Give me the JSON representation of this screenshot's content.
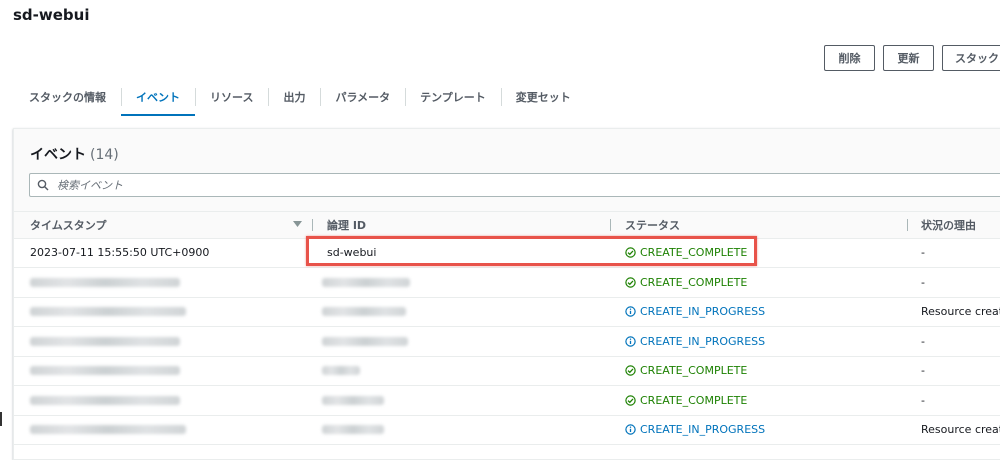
{
  "header": {
    "stack_name": "sd-webui"
  },
  "actions": {
    "delete_label": "削除",
    "update_label": "更新",
    "stack_actions_label": "スタックア"
  },
  "tabs": [
    {
      "label": "スタックの情報",
      "active": false
    },
    {
      "label": "イベント",
      "active": true
    },
    {
      "label": "リソース",
      "active": false
    },
    {
      "label": "出力",
      "active": false
    },
    {
      "label": "パラメータ",
      "active": false
    },
    {
      "label": "テンプレート",
      "active": false
    },
    {
      "label": "変更セット",
      "active": false
    }
  ],
  "events": {
    "title": "イベント",
    "count": "(14)",
    "search_placeholder": "検索イベント",
    "columns": {
      "timestamp": "タイムスタンプ",
      "logical_id": "論理 ID",
      "status": "ステータス",
      "reason": "状況の理由"
    },
    "rows": [
      {
        "timestamp": "2023-07-11 15:55:50 UTC+0900",
        "logical_id": "sd-webui",
        "status": "CREATE_COMPLETE",
        "status_type": "complete",
        "reason": "-"
      },
      {
        "timestamp": "",
        "logical_id": "",
        "status": "CREATE_COMPLETE",
        "status_type": "complete",
        "reason": "-"
      },
      {
        "timestamp": "",
        "logical_id": "",
        "status": "CREATE_IN_PROGRESS",
        "status_type": "progress",
        "reason": "Resource creation"
      },
      {
        "timestamp": "",
        "logical_id": "",
        "status": "CREATE_IN_PROGRESS",
        "status_type": "progress",
        "reason": "-"
      },
      {
        "timestamp": "",
        "logical_id": "",
        "status": "CREATE_COMPLETE",
        "status_type": "complete",
        "reason": "-"
      },
      {
        "timestamp": "",
        "logical_id": "",
        "status": "CREATE_COMPLETE",
        "status_type": "complete",
        "reason": "-"
      },
      {
        "timestamp": "",
        "logical_id": "",
        "status": "CREATE_IN_PROGRESS",
        "status_type": "progress",
        "reason": "Resource creation"
      }
    ]
  },
  "colors": {
    "accent": "#0073bb",
    "success": "#1d8102",
    "highlight": "#e8534a"
  }
}
